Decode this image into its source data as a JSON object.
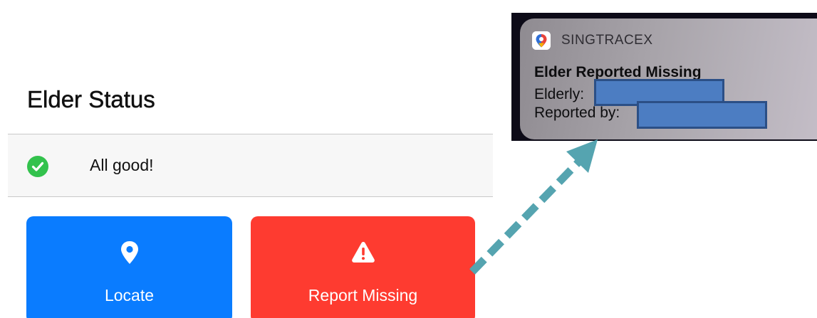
{
  "elder_status": {
    "title": "Elder Status",
    "status_text": "All good!",
    "status_icon": "check-circle-icon",
    "status_color": "#33c24d"
  },
  "actions": {
    "locate": {
      "label": "Locate",
      "icon": "map-pin-icon",
      "color": "#0a7cff"
    },
    "report_missing": {
      "label": "Report Missing",
      "icon": "warning-triangle-icon",
      "color": "#fe3b30"
    }
  },
  "notification": {
    "app_name": "SINGTRACEX",
    "app_icon": "singtracex-app-icon",
    "title": "Elder Reported Missing",
    "elderly_label": "Elderly:",
    "reported_by_label": "Reported by:",
    "redaction_color": "#4c7dc2"
  },
  "arrow": {
    "style": "dashed",
    "color": "#55a4b0",
    "direction": "from report-missing button to notification"
  }
}
